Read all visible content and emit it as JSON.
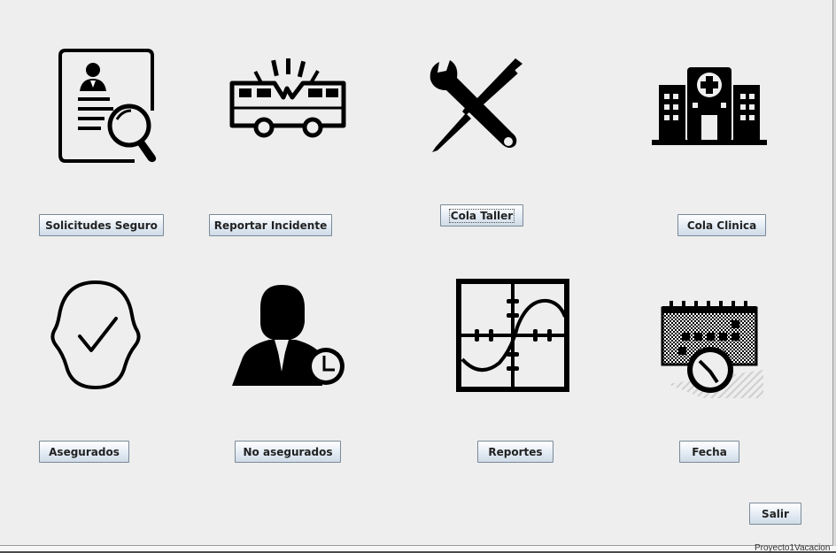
{
  "buttons": {
    "solicitudes": "Solicitudes Seguro",
    "reportar": "Reportar Incidente",
    "cola_taller": "Cola Taller",
    "cola_clinica": "Cola Clinica",
    "asegurados": "Asegurados",
    "no_asegurados": "No asegurados",
    "reportes": "Reportes",
    "fecha": "Fecha",
    "salir": "Salir"
  },
  "footer": {
    "text": "Proyecto1Vacacion"
  },
  "icons": [
    "document-search-icon",
    "car-crash-icon",
    "tools-icon",
    "hospital-icon",
    "insured-person-icon",
    "person-clock-icon",
    "graph-icon",
    "calendar-clock-icon"
  ],
  "colors": {
    "panel": "#eeeeee",
    "icon": "#000000",
    "button_border": "#7a8a99"
  }
}
